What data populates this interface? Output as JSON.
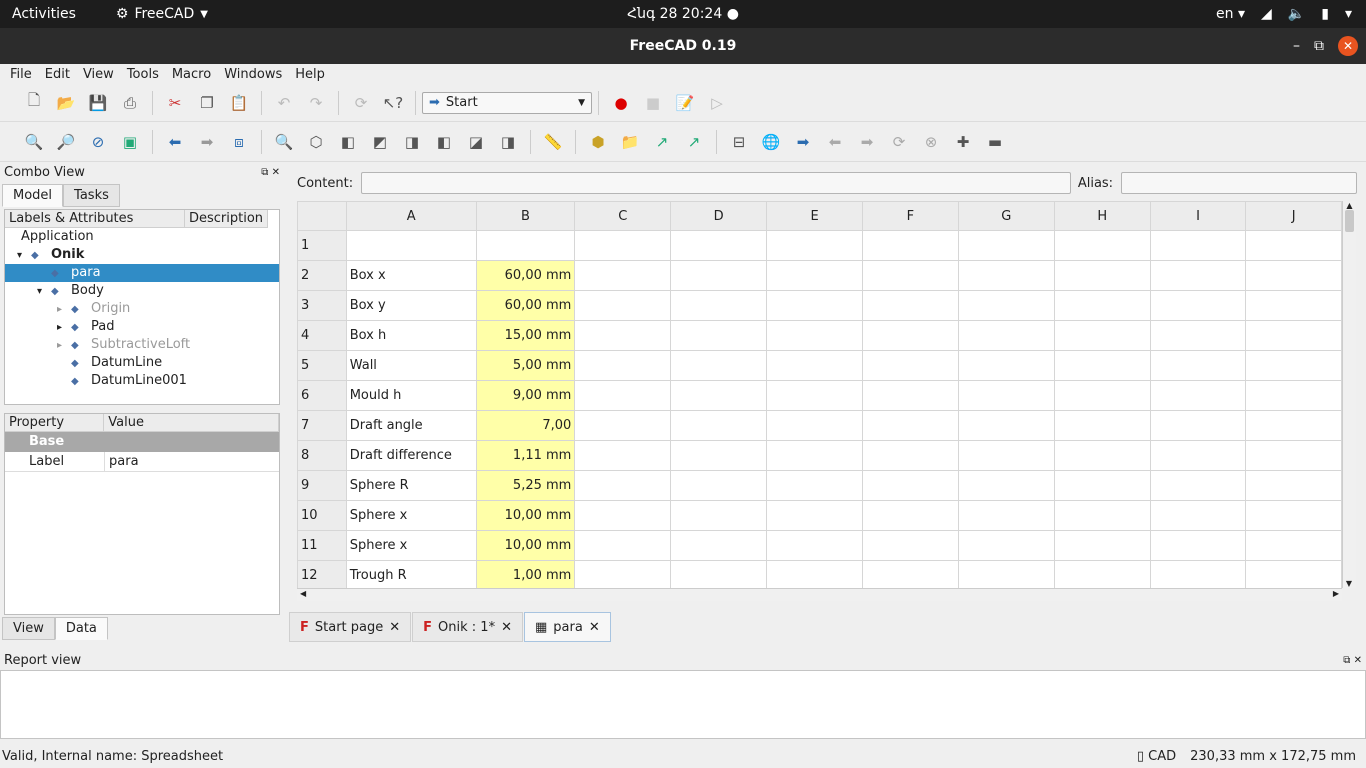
{
  "system": {
    "activities": "Activities",
    "app": "FreeCAD",
    "clock": "Հնգ 28  20:24",
    "lang": "en"
  },
  "window": {
    "title": "FreeCAD 0.19"
  },
  "menu": [
    "File",
    "Edit",
    "View",
    "Tools",
    "Macro",
    "Windows",
    "Help"
  ],
  "workbench": "Start",
  "combo": {
    "title": "Combo View",
    "tabs": [
      "Model",
      "Tasks"
    ],
    "col_labels": "Labels & Attributes",
    "col_desc": "Description",
    "tree": [
      {
        "label": "Application",
        "level": 0,
        "expander": ""
      },
      {
        "label": "Onik",
        "level": 1,
        "expander": "▾",
        "bold": true
      },
      {
        "label": "para",
        "level": 2,
        "expander": "",
        "selected": true
      },
      {
        "label": "Body",
        "level": 2,
        "expander": "▾"
      },
      {
        "label": "Origin",
        "level": 3,
        "expander": "▸",
        "dim": true
      },
      {
        "label": "Pad",
        "level": 3,
        "expander": "▸"
      },
      {
        "label": "SubtractiveLoft",
        "level": 3,
        "expander": "▸",
        "dim": true
      },
      {
        "label": "DatumLine",
        "level": 3,
        "expander": ""
      },
      {
        "label": "DatumLine001",
        "level": 3,
        "expander": ""
      }
    ]
  },
  "props": {
    "col_property": "Property",
    "col_value": "Value",
    "group": "Base",
    "rows": [
      {
        "name": "Label",
        "value": "para"
      }
    ],
    "tabs": [
      "View",
      "Data"
    ]
  },
  "sheet": {
    "content_label": "Content:",
    "alias_label": "Alias:",
    "columns": [
      "A",
      "B",
      "C",
      "D",
      "E",
      "F",
      "G",
      "H",
      "I",
      "J"
    ],
    "rows": [
      {
        "n": "1",
        "a": "",
        "b": ""
      },
      {
        "n": "2",
        "a": "Box x",
        "b": "60,00 mm"
      },
      {
        "n": "3",
        "a": "Box y",
        "b": "60,00 mm"
      },
      {
        "n": "4",
        "a": "Box h",
        "b": "15,00 mm"
      },
      {
        "n": "5",
        "a": "Wall",
        "b": "5,00 mm"
      },
      {
        "n": "6",
        "a": "Mould h",
        "b": "9,00 mm"
      },
      {
        "n": "7",
        "a": "Draft angle",
        "b": "7,00"
      },
      {
        "n": "8",
        "a": "Draft difference",
        "b": "1,11 mm"
      },
      {
        "n": "9",
        "a": "Sphere R",
        "b": "5,25 mm"
      },
      {
        "n": "10",
        "a": "Sphere x",
        "b": "10,00 mm"
      },
      {
        "n": "11",
        "a": "Sphere x",
        "b": "10,00 mm"
      },
      {
        "n": "12",
        "a": "Trough R",
        "b": "1,00 mm"
      }
    ]
  },
  "doctabs": [
    {
      "label": "Start page"
    },
    {
      "label": "Onik : 1*"
    },
    {
      "label": "para",
      "active": true
    }
  ],
  "report": {
    "title": "Report view"
  },
  "status": {
    "left": "Valid, Internal name: Spreadsheet",
    "nav": "CAD",
    "dims": "230,33 mm x 172,75 mm"
  }
}
